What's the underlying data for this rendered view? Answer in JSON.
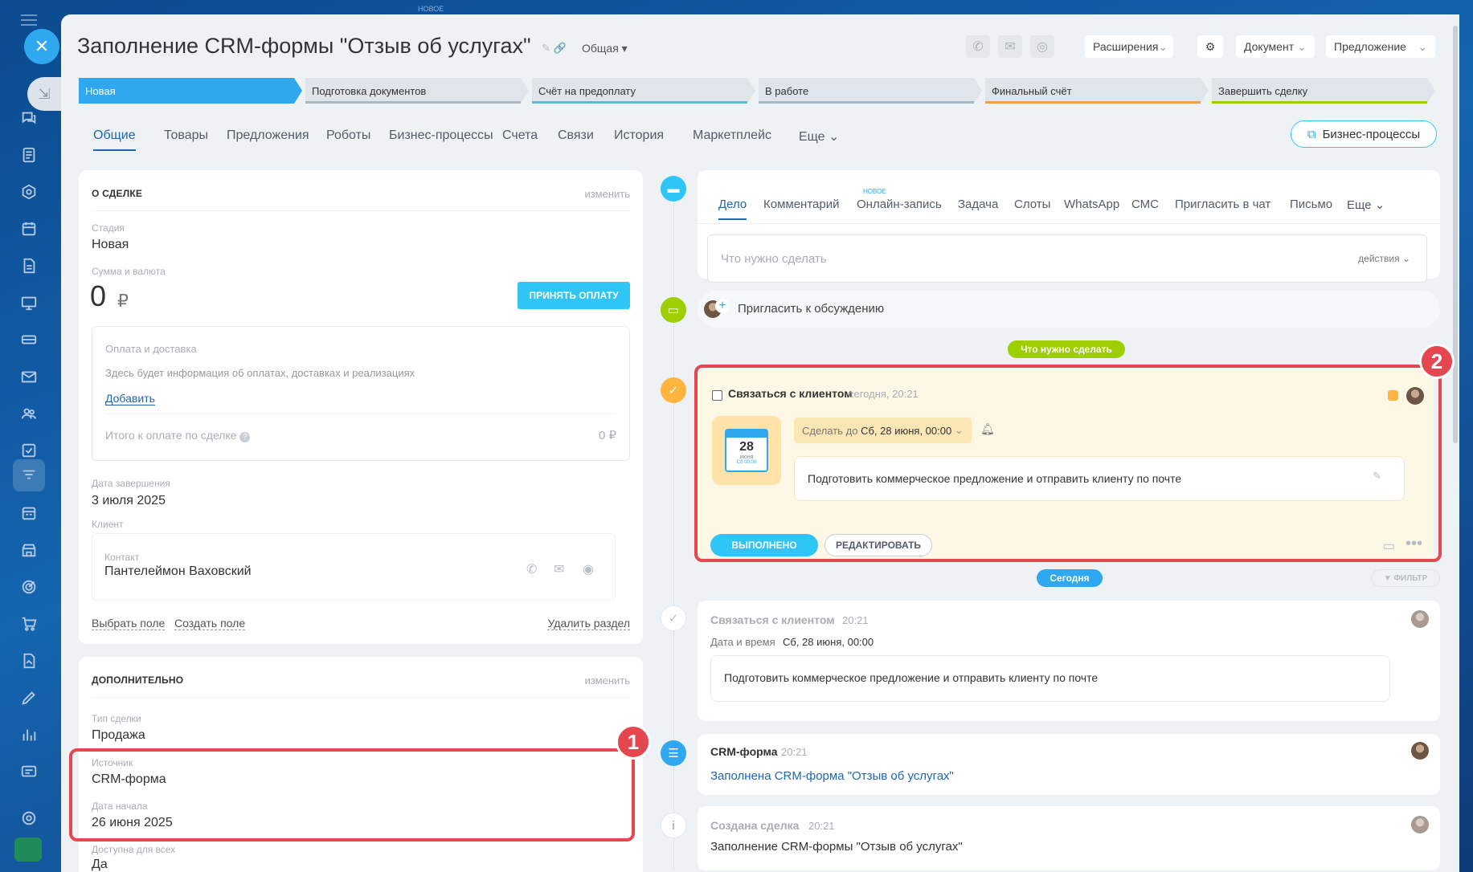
{
  "top_badge": "НОВОЕ",
  "header": {
    "title": "Заполнение CRM-формы \"Отзыв об услугах\"",
    "category": "Общая",
    "buttons": {
      "extensions": "Расширения",
      "document": "Документ",
      "offer": "Предложение"
    }
  },
  "stages": [
    "Новая",
    "Подготовка документов",
    "Счёт на предоплату",
    "В работе",
    "Финальный счёт",
    "Завершить сделку"
  ],
  "tabs": [
    "Общие",
    "Товары",
    "Предложения",
    "Роботы",
    "Бизнес-процессы",
    "Счета",
    "Связи",
    "История",
    "Маркетплейс",
    "Еще"
  ],
  "bp_button": "Бизнес-процессы",
  "deal": {
    "section_title": "О СДЕЛКЕ",
    "edit": "изменить",
    "stage_label": "Стадия",
    "stage_value": "Новая",
    "amount_label": "Сумма и валюта",
    "amount_value": "0",
    "currency": "₽",
    "pay_button": "ПРИНЯТЬ ОПЛАТУ",
    "payment_title": "Оплата и доставка",
    "payment_info": "Здесь будет информация об оплатах, доставках и реализациях",
    "add_link": "Добавить",
    "total_label": "Итого к оплате по сделке",
    "total_value": "0 ₽",
    "close_date_label": "Дата завершения",
    "close_date_value": "3 июля 2025",
    "client_label": "Клиент",
    "contact_label": "Контакт",
    "contact_name": "Пантелеймон Ваховский",
    "select_field": "Выбрать поле",
    "create_field": "Создать поле",
    "delete_section": "Удалить раздел"
  },
  "extra": {
    "section_title": "ДОПОЛНИТЕЛЬНО",
    "edit": "изменить",
    "type_label": "Тип сделки",
    "type_value": "Продажа",
    "source_label": "Источник",
    "source_value": "CRM-форма",
    "start_label": "Дата начала",
    "start_value": "26 июня 2025",
    "public_label": "Доступна для всех",
    "public_value": "Да"
  },
  "badges": {
    "one": "1",
    "two": "2"
  },
  "activity": {
    "tabs": [
      "Дело",
      "Комментарий",
      "Онлайн-запись",
      "Задача",
      "Слоты",
      "WhatsApp",
      "СМС",
      "Пригласить в чат",
      "Письмо",
      "Еще"
    ],
    "new_badge": "НОВОЕ",
    "input_placeholder": "Что нужно сделать",
    "actions": "действия",
    "invite": "Пригласить к обсуждению"
  },
  "todo_pill": "Что нужно сделать",
  "task": {
    "title": "Связаться с клиентом",
    "time": "сегодня, 20:21",
    "cal_day": "28",
    "cal_month": "июня",
    "cal_time": "Сб 00:00",
    "deadline_label": "Сделать до",
    "deadline_value": "Сб, 28 июня, 00:00",
    "text": "Подготовить коммерческое предложение и отправить клиенту по почте",
    "done_button": "ВЫПОЛНЕНО",
    "edit_button": "РЕДАКТИРОВАТЬ"
  },
  "today_pill": "Сегодня",
  "filter": "ФИЛЬТР",
  "history": [
    {
      "title": "Связаться с клиентом",
      "time": "20:21",
      "line_label": "Дата и время",
      "line_value": "Сб, 28 июня, 00:00",
      "text": "Подготовить коммерческое предложение и отправить клиенту по почте"
    },
    {
      "title": "CRM-форма",
      "time": "20:21",
      "link": "Заполнена CRM-форма \"Отзыв об услугах\""
    },
    {
      "title": "Создана сделка",
      "time": "20:21",
      "text": "Заполнение CRM-формы \"Отзыв об услугах\""
    }
  ],
  "colors": {
    "accent": "#2fc6f6",
    "stage_new": "#2fa8f0",
    "highlight": "#e4474f",
    "link": "#2066b0",
    "green": "#9dcf00"
  }
}
